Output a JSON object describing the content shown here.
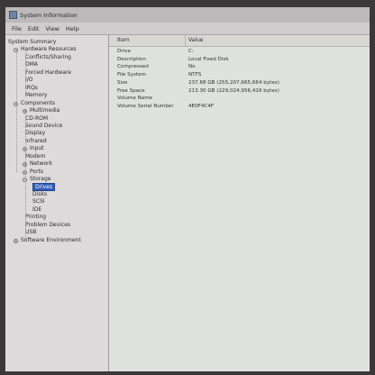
{
  "window": {
    "title": "System Information"
  },
  "menu": [
    "File",
    "Edit",
    "View",
    "Help"
  ],
  "tree": [
    {
      "label": "System Summary",
      "level": 0,
      "expander": "",
      "name": "system-summary"
    },
    {
      "label": "Hardware Resources",
      "level": 1,
      "expander": "−",
      "name": "hardware-resources"
    },
    {
      "label": "Conflicts/Sharing",
      "level": 2,
      "expander": "",
      "name": "conflicts-sharing"
    },
    {
      "label": "DMA",
      "level": 2,
      "expander": "",
      "name": "dma"
    },
    {
      "label": "Forced Hardware",
      "level": 2,
      "expander": "",
      "name": "forced-hardware"
    },
    {
      "label": "I/O",
      "level": 2,
      "expander": "",
      "name": "io"
    },
    {
      "label": "IRQs",
      "level": 2,
      "expander": "",
      "name": "irqs"
    },
    {
      "label": "Memory",
      "level": 2,
      "expander": "",
      "name": "memory"
    },
    {
      "label": "Components",
      "level": 1,
      "expander": "−",
      "name": "components"
    },
    {
      "label": "Multimedia",
      "level": 2,
      "expander": "+",
      "name": "multimedia"
    },
    {
      "label": "CD-ROM",
      "level": 2,
      "expander": "",
      "name": "cd-rom"
    },
    {
      "label": "Sound Device",
      "level": 2,
      "expander": "",
      "name": "sound-device"
    },
    {
      "label": "Display",
      "level": 2,
      "expander": "",
      "name": "display"
    },
    {
      "label": "Infrared",
      "level": 2,
      "expander": "",
      "name": "infrared"
    },
    {
      "label": "Input",
      "level": 2,
      "expander": "+",
      "name": "input"
    },
    {
      "label": "Modem",
      "level": 2,
      "expander": "",
      "name": "modem"
    },
    {
      "label": "Network",
      "level": 2,
      "expander": "+",
      "name": "network"
    },
    {
      "label": "Ports",
      "level": 2,
      "expander": "+",
      "name": "ports"
    },
    {
      "label": "Storage",
      "level": 2,
      "expander": "−",
      "name": "storage"
    },
    {
      "label": "Drives",
      "level": 3,
      "expander": "",
      "name": "drives",
      "selected": true
    },
    {
      "label": "Disks",
      "level": 3,
      "expander": "",
      "name": "disks"
    },
    {
      "label": "SCSI",
      "level": 3,
      "expander": "",
      "name": "scsi"
    },
    {
      "label": "IDE",
      "level": 3,
      "expander": "",
      "name": "ide"
    },
    {
      "label": "Printing",
      "level": 2,
      "expander": "",
      "name": "printing"
    },
    {
      "label": "Problem Devices",
      "level": 2,
      "expander": "",
      "name": "problem-devices"
    },
    {
      "label": "USB",
      "level": 2,
      "expander": "",
      "name": "usb"
    },
    {
      "label": "Software Environment",
      "level": 1,
      "expander": "+",
      "name": "software-environment"
    }
  ],
  "details": {
    "columns": {
      "item": "Item",
      "value": "Value"
    },
    "rows": [
      {
        "item": "Drive",
        "value": "C:"
      },
      {
        "item": "Description",
        "value": "Local Fixed Disk"
      },
      {
        "item": "Compressed",
        "value": "No"
      },
      {
        "item": "File System",
        "value": "NTFS"
      },
      {
        "item": "Size",
        "value": "237.68 GB (255,207,665,664 bytes)"
      },
      {
        "item": "Free Space",
        "value": "213.30 GB (229,024,956,416 bytes)"
      },
      {
        "item": "Volume Name",
        "value": ""
      },
      {
        "item": "Volume Serial Number",
        "value": "4E0F4C4F"
      }
    ]
  }
}
